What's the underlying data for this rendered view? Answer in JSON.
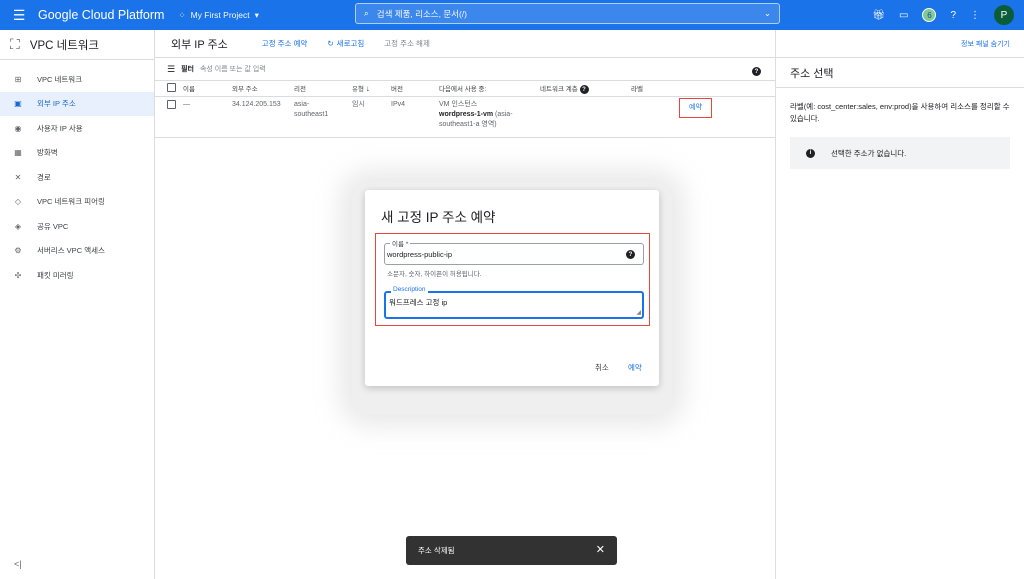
{
  "topbar": {
    "brand": "Google Cloud Platform",
    "project": "My First Project",
    "search_placeholder": "검색  제품, 리소스, 문서(/)",
    "notification_count": "6",
    "avatar_letter": "P"
  },
  "sidebar": {
    "title": "VPC 네트워크",
    "items": [
      {
        "label": "VPC 네트워크",
        "icon": "⊞"
      },
      {
        "label": "외부 IP 주소",
        "icon": "▣"
      },
      {
        "label": "사용자 IP 사용",
        "icon": "◉"
      },
      {
        "label": "방화벽",
        "icon": "▦"
      },
      {
        "label": "경로",
        "icon": "✕"
      },
      {
        "label": "VPC 네트워크 피어링",
        "icon": "◇"
      },
      {
        "label": "공유 VPC",
        "icon": "◈"
      },
      {
        "label": "서버리스 VPC 액세스",
        "icon": "⚙"
      },
      {
        "label": "패킷 미러링",
        "icon": "✣"
      }
    ],
    "collapse_icon": "<|"
  },
  "main": {
    "title": "외부 IP 주소",
    "actions": {
      "reserve_static": "고정 주소 예약",
      "refresh": "새로고침",
      "release_static": "고정 주소 해제"
    },
    "filter_label": "필터",
    "filter_placeholder": "속성 이름 또는 값 입력",
    "table": {
      "headers": [
        "이름",
        "외부 주소",
        "리전",
        "유형",
        "버전",
        "다음에서 사용 중:",
        "네트워크 계층",
        "라벨"
      ],
      "rows": [
        {
          "name": "—",
          "address": "34.124.205.153",
          "region_line1": "asia-",
          "region_line2": "southeast1",
          "type": "임시",
          "version": "IPv4",
          "inuse_line1": "VM 인스턴스",
          "inuse_vm": "wordpress-1-vm",
          "inuse_zone1": " (asia-",
          "inuse_zone2": "southeast1-a 영역)",
          "action": "예약"
        }
      ]
    }
  },
  "rpanel": {
    "hide_panel": "정보 패널 숨기기",
    "title": "주소 선택",
    "description": "라벨(예: cost_center:sales, env:prod)을 사용하여 리소스를 정리할 수 있습니다.",
    "info": "선택한 주소가 없습니다."
  },
  "dialog": {
    "title": "새 고정 IP 주소 예약",
    "name_label": "이름 *",
    "name_value": "wordpress-public-ip",
    "name_hint": "소문자, 숫자, 하이픈이 허용됩니다.",
    "desc_label": "Description",
    "desc_value": "워드프레스 고정 ip",
    "cancel": "취소",
    "reserve": "예약"
  },
  "snackbar": {
    "message": "주소 삭제됨",
    "close": "✕"
  },
  "colors": {
    "primary": "#1a73e8",
    "highlight": "#e8453c"
  }
}
